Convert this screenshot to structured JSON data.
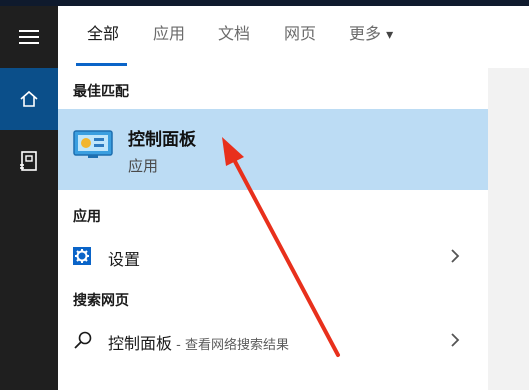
{
  "tabs": [
    {
      "label": "全部",
      "active": true
    },
    {
      "label": "应用"
    },
    {
      "label": "文档"
    },
    {
      "label": "网页"
    },
    {
      "label": "更多"
    }
  ],
  "more_caret": "▾",
  "sections": {
    "best_match": "最佳匹配",
    "apps": "应用",
    "web": "搜索网页"
  },
  "best_match": {
    "title": "控制面板",
    "subtitle": "应用",
    "icon": "control-panel-icon"
  },
  "app_results": [
    {
      "label": "设置",
      "icon": "settings-gear-icon"
    }
  ],
  "web_results": [
    {
      "label": "控制面板",
      "hint": " - 查看网络搜索结果",
      "icon": "search-icon"
    }
  ],
  "rail": {
    "items": [
      "hamburger-menu-icon",
      "home-icon",
      "document-icon"
    ]
  },
  "colors": {
    "accent": "#0a64c8",
    "selection": "#bcdcf4",
    "rail": "#1f1f1f",
    "rail_active": "#0b4f8a",
    "annotation_arrow": "#e8301c"
  }
}
